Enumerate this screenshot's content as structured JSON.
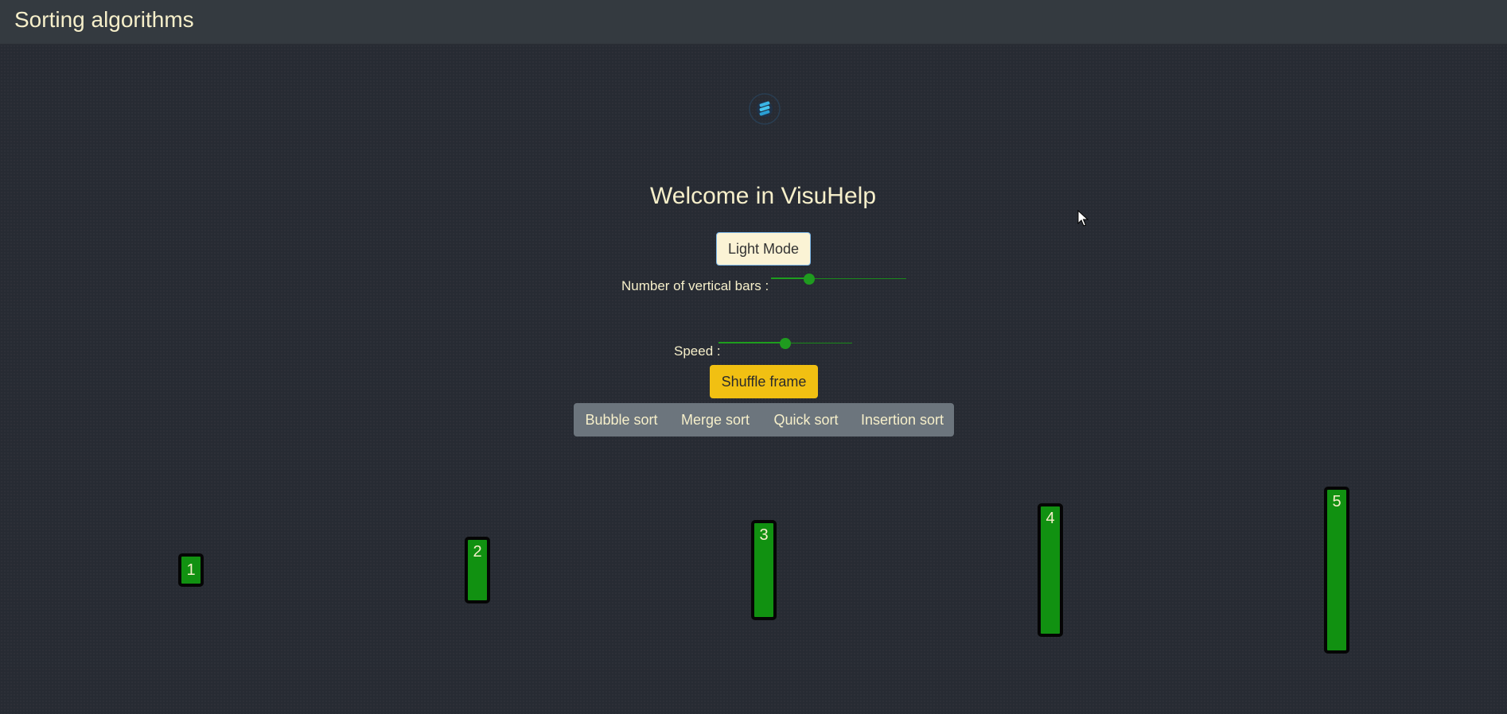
{
  "navbar": {
    "title": "Sorting algorithms"
  },
  "main": {
    "welcome": "Welcome in VisuHelp",
    "light_mode_label": "Light Mode",
    "bars_label": "Number of vertical bars :",
    "bars_slider_level": 0.28,
    "speed_label": "Speed :",
    "speed_slider_level": 0.5,
    "shuffle_label": "Shuffle frame",
    "algorithms": [
      "Bubble sort",
      "Merge sort",
      "Quick sort",
      "Insertion sort"
    ]
  },
  "bars": [
    "1",
    "2",
    "3",
    "4",
    "5"
  ],
  "bar_values": [
    1,
    2,
    3,
    4,
    5
  ],
  "colors": {
    "background": "#272b33",
    "navbar": "#343a40",
    "text": "#f6efca",
    "bar_fill": "#119111",
    "slider": "#1f9b1f",
    "shuffle_button": "#f1c012",
    "algo_group": "#6c757d"
  },
  "icons": [
    "app-logo-icon",
    "mouse-cursor-icon"
  ]
}
